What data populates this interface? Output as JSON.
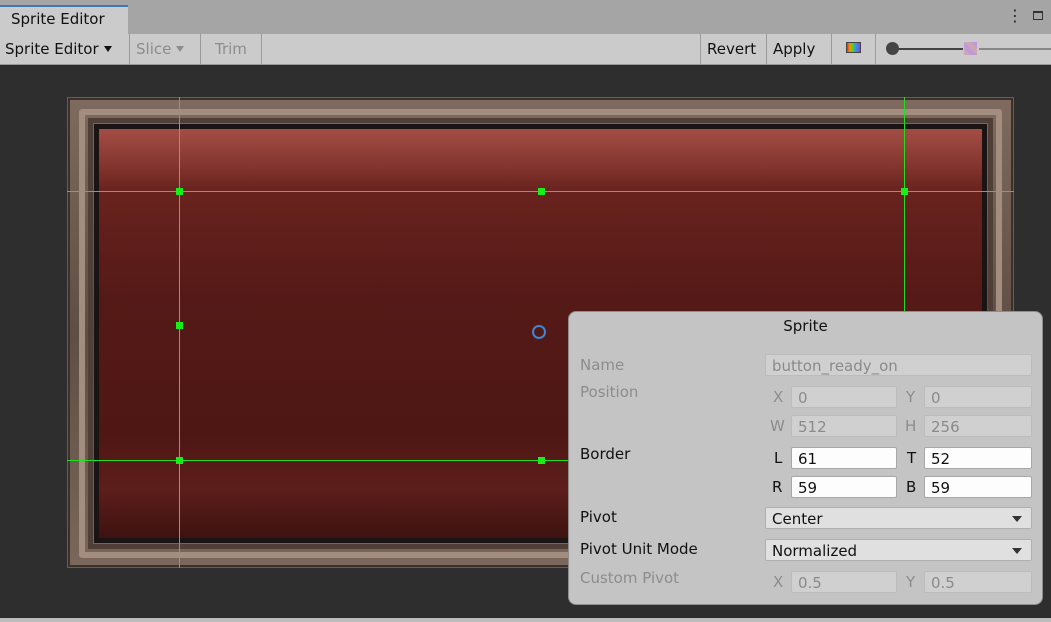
{
  "tab": {
    "title": "Sprite Editor"
  },
  "toolbar": {
    "sprite_editor": "Sprite Editor",
    "slice": "Slice",
    "trim": "Trim",
    "revert": "Revert",
    "apply": "Apply"
  },
  "panel": {
    "title": "Sprite",
    "name_label": "Name",
    "name_value": "button_ready_on",
    "position_label": "Position",
    "x_label": "X",
    "x_value": "0",
    "y_label": "Y",
    "y_value": "0",
    "w_label": "W",
    "w_value": "512",
    "h_label": "H",
    "h_value": "256",
    "border_label": "Border",
    "l_label": "L",
    "l_value": "61",
    "t_label": "T",
    "t_value": "52",
    "r_label": "R",
    "r_value": "59",
    "b_label": "B",
    "b_value": "59",
    "pivot_label": "Pivot",
    "pivot_value": "Center",
    "pivot_unit_label": "Pivot Unit Mode",
    "pivot_unit_value": "Normalized",
    "custom_pivot_label": "Custom Pivot",
    "cp_x_label": "X",
    "cp_x_value": "0.5",
    "cp_y_label": "Y",
    "cp_y_value": "0.5"
  },
  "colors": {
    "guide": "#21e021",
    "accent": "#3a79bb",
    "sprite": "#551a17"
  }
}
